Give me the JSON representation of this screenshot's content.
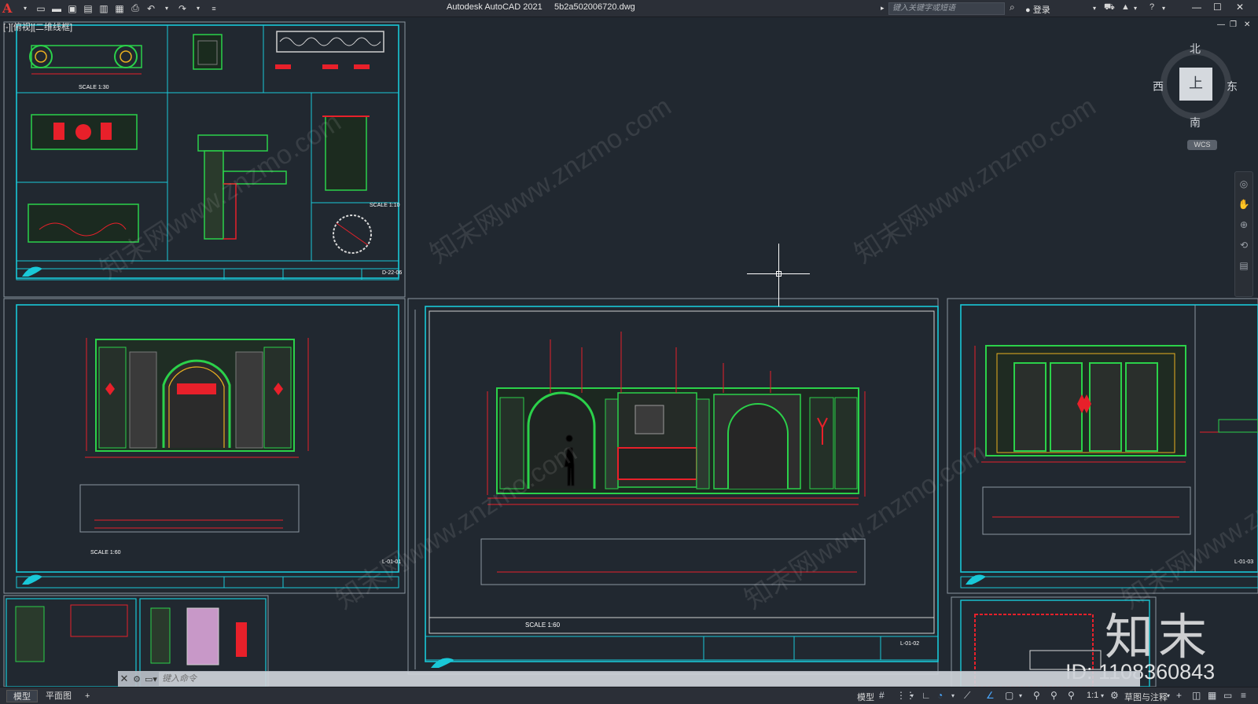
{
  "window": {
    "app_title": "Autodesk AutoCAD 2021",
    "file_name": "5b2a502006720.dwg",
    "search_placeholder": "键入关键字或短语",
    "login_label": "登录"
  },
  "viewport": {
    "label": "[-][俯视][二维线框]"
  },
  "viewcube": {
    "north": "北",
    "south": "南",
    "east": "东",
    "west": "西",
    "face": "上",
    "wcs": "WCS"
  },
  "sheets": {
    "scale_label": "SCALE 1:60",
    "scale_1_30": "SCALE 1:30",
    "scale_1_10": "SCALE 1:10",
    "scale_1_60_b": "SCALE 1:60",
    "sheet_nos": [
      "D-22-06",
      "L-01-01",
      "L-01-02",
      "L-01-03"
    ]
  },
  "command_line": {
    "placeholder": "键入命令"
  },
  "status_bar": {
    "tabs": [
      "模型",
      "平面图",
      "+"
    ],
    "model_label": "模型",
    "scale": "1:1",
    "workspace": "草图与注释"
  },
  "watermark": {
    "brand": "知末",
    "id": "ID: 1108360843",
    "site": "知末网www.znzmo.com"
  },
  "colors": {
    "background": "#212830",
    "frame_cyan": "#19c8d8",
    "line_green": "#2bd14a",
    "line_red": "#e8202a",
    "text_white": "#ffffff"
  }
}
